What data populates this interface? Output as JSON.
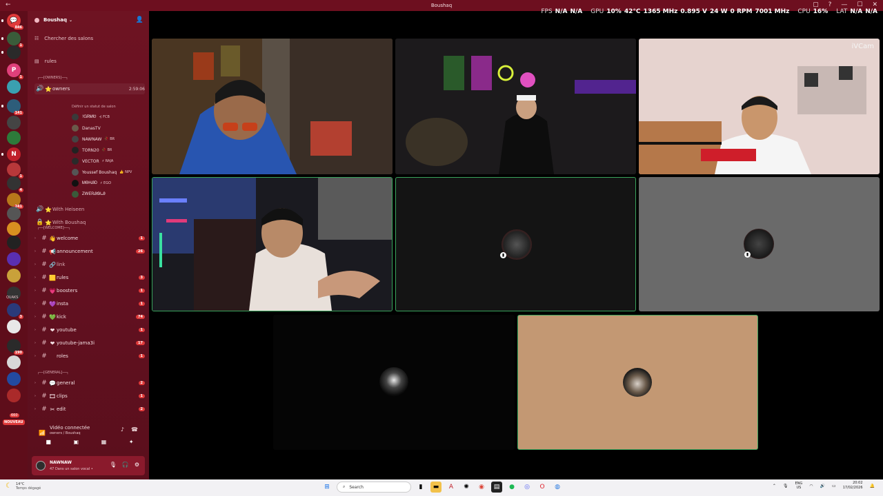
{
  "window": {
    "title": "Boushaq"
  },
  "overlay_stats": {
    "fps_label": "FPS",
    "fps_val": "N/A",
    "fps_val2": "N/A",
    "gpu_label": "GPU",
    "gpu_util": "10%",
    "gpu_temp": "42°C",
    "gpu_clock": "1365 MHz",
    "gpu_volt": "0.895 V",
    "gpu_power": "24 W",
    "gpu_fan": "0 RPM",
    "gpu_mem": "7001 MHz",
    "cpu_label": "CPU",
    "cpu_util": "16%",
    "lat_label": "LAT",
    "lat_val": "N/A",
    "lat_val2": "N/A"
  },
  "rail": {
    "servers": [
      {
        "icon": "💬",
        "badge": "846",
        "color": "#e03a3a"
      },
      {
        "icon": "",
        "badge": "1",
        "color": "#3a5c3a"
      },
      {
        "icon": "",
        "badge": "",
        "color": "#2a2a2a"
      },
      {
        "icon": "P",
        "badge": "1",
        "color": "#e0407a"
      },
      {
        "icon": "",
        "badge": "",
        "color": "#3aa0b0"
      },
      {
        "icon": "",
        "badge": "141",
        "color": "#2d5d7a"
      },
      {
        "icon": "",
        "badge": "",
        "color": "#444"
      },
      {
        "icon": "",
        "badge": "",
        "color": "#2d7a3a"
      },
      {
        "icon": "N",
        "badge": "",
        "color": "#c0202a"
      },
      {
        "icon": "",
        "badge": "1",
        "color": "#b8383a"
      },
      {
        "icon": "",
        "badge": "4",
        "color": "#333"
      },
      {
        "icon": "",
        "badge": "241",
        "color": "#b8781a"
      },
      {
        "icon": "",
        "badge": "",
        "color": "#555"
      },
      {
        "icon": "",
        "badge": "",
        "color": "#d89020"
      },
      {
        "icon": "",
        "badge": "",
        "color": "#222"
      },
      {
        "icon": "",
        "badge": "",
        "color": "#5a2fb0"
      },
      {
        "icon": "",
        "badge": "",
        "color": "#c9a13a"
      },
      {
        "icon": "",
        "badge": "",
        "color": "#333"
      },
      {
        "icon": "",
        "badge": "3",
        "color": "#2a3a7a"
      },
      {
        "icon": "",
        "badge": "",
        "color": "#e8e8e8"
      },
      {
        "icon": "",
        "badge": "190",
        "color": "#2a2a2a"
      },
      {
        "icon": "",
        "badge": "",
        "color": "#d8d8d8"
      },
      {
        "icon": "",
        "badge": "",
        "color": "#234aa0"
      },
      {
        "icon": "",
        "badge": "",
        "color": "#aa2a2a"
      }
    ],
    "new_badge": "NOUVEAU",
    "new_count": "660",
    "text_label": "QUAKS"
  },
  "sidebar": {
    "server_name": "Boushaq",
    "search": "Chercher des salons",
    "rules_top": "rules",
    "cat_owners": "┌──[OWNERS]──┐",
    "owners_channel": "owners",
    "owners_time": "2:59:06",
    "owners_status": "Définir un statut de salon",
    "members": [
      {
        "name": "!ᏀᏒᎷᎧ",
        "tag": "⊰ FCB",
        "av": "#3a3a3a",
        "cam": true
      },
      {
        "name": "DanasTV",
        "tag": "",
        "av": "#6a5a4a",
        "cam": true
      },
      {
        "name": "NAWNAW",
        "tag": "🥀 BR",
        "av": "#444",
        "cam": true
      },
      {
        "name": "TORN20",
        "tag": "🥀 BR",
        "av": "#222",
        "cam": false
      },
      {
        "name": "VECTOR",
        "tag": "⚡ RAJA",
        "av": "#2a2a2a",
        "cam": false
      },
      {
        "name": "Youssef Boushaq",
        "tag": "👍 NPV",
        "av": "#555",
        "cam": true
      },
      {
        "name": "ᎷᎾᎻᎯᎠ",
        "tag": "⚡ EGO",
        "av": "#111",
        "cam": false
      },
      {
        "name": "ᏃᎳᎬᏒᎯᏫᏓᎯ",
        "tag": "",
        "av": "#3a5a3a",
        "cam": false
      }
    ],
    "with_heiseen": "With Heiseen",
    "with_boushaq": "With Boushaq",
    "cat_welcome": "┌──[WELCOME]──┐",
    "channels_welcome": [
      {
        "emoji": "👋",
        "name": "welcome",
        "count": "1"
      },
      {
        "emoji": "📢",
        "name": "announcement",
        "count": "26"
      },
      {
        "emoji": "🔗",
        "name": "link",
        "count": ""
      },
      {
        "emoji": "🟨",
        "name": "rules",
        "count": "3"
      },
      {
        "emoji": "💗",
        "name": "boosters",
        "count": "1"
      },
      {
        "emoji": "💜",
        "name": "insta",
        "count": "1"
      },
      {
        "emoji": "💚",
        "name": "kick",
        "count": "74"
      },
      {
        "emoji": "❤",
        "name": "youtube",
        "count": "1"
      },
      {
        "emoji": "❤",
        "name": "youtube-jama3i",
        "count": "17"
      },
      {
        "emoji": "",
        "name": "roles",
        "count": "1"
      }
    ],
    "cat_general": "┌──[GENERAL]──┐",
    "channels_general": [
      {
        "emoji": "💬",
        "name": "general",
        "count": "2"
      },
      {
        "emoji": "🎞",
        "name": "clips",
        "count": "1"
      },
      {
        "emoji": "✂",
        "name": "edit",
        "count": "2"
      }
    ],
    "voice": {
      "title": "Vidéo connectée",
      "sub": "owners / Boushaq"
    },
    "user": {
      "name": "NAWNAW",
      "status": "47 Dans un salon vocal •"
    }
  },
  "stage": {
    "watermark": "iVCam"
  },
  "taskbar": {
    "temp": "14°C",
    "weather": "Temps dégagé",
    "search": "Search",
    "lang": "ENG",
    "region": "US",
    "time": "20:02",
    "date": "17/02/2026"
  },
  "colors": {
    "sidebar": "#6e1322",
    "rail": "#5e0d1a",
    "speaking_border": "#3aa55d",
    "badge": "#e03a3a"
  }
}
